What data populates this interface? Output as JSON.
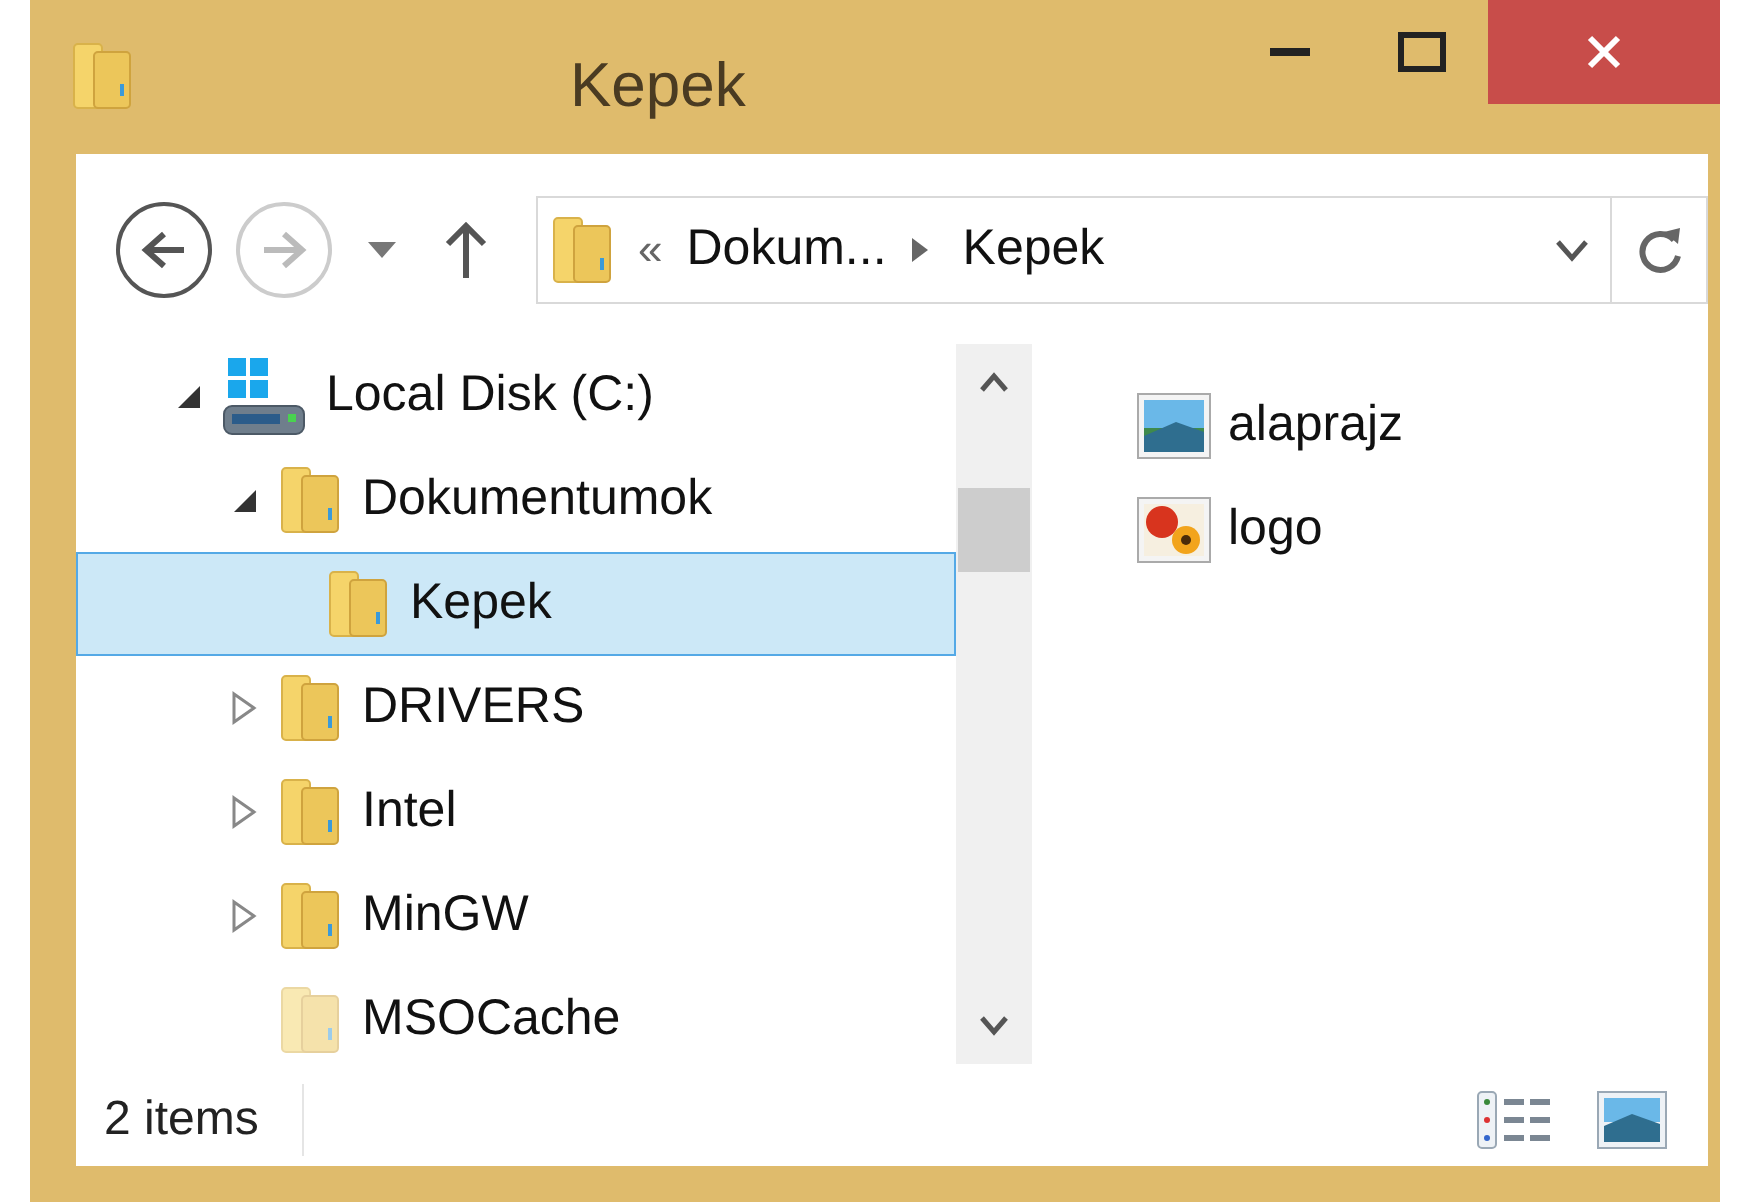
{
  "window": {
    "title": "Kepek"
  },
  "nav": {
    "back_disabled": false,
    "forward_disabled": true
  },
  "address": {
    "overflow": "«",
    "crumbs": [
      "Dokum...",
      "Kepek"
    ]
  },
  "tree": [
    {
      "label": "Local Disk (C:)",
      "kind": "drive",
      "expandable": true,
      "expanded": true,
      "selected": false,
      "children": [
        {
          "label": "Dokumentumok",
          "kind": "folder",
          "expandable": true,
          "expanded": true,
          "selected": false,
          "children": [
            {
              "label": "Kepek",
              "kind": "folder",
              "expandable": false,
              "expanded": false,
              "selected": true
            }
          ]
        },
        {
          "label": "DRIVERS",
          "kind": "folder",
          "expandable": true,
          "expanded": false,
          "selected": false
        },
        {
          "label": "Intel",
          "kind": "folder",
          "expandable": true,
          "expanded": false,
          "selected": false
        },
        {
          "label": "MinGW",
          "kind": "folder",
          "expandable": true,
          "expanded": false,
          "selected": false
        },
        {
          "label": "MSOCache",
          "kind": "hidden-folder",
          "expandable": false,
          "expanded": false,
          "selected": false
        }
      ]
    }
  ],
  "files": [
    {
      "name": "alaprajz",
      "kind": "landscape"
    },
    {
      "name": "logo",
      "kind": "flowers"
    }
  ],
  "status_bar": {
    "count": "2 items"
  }
}
